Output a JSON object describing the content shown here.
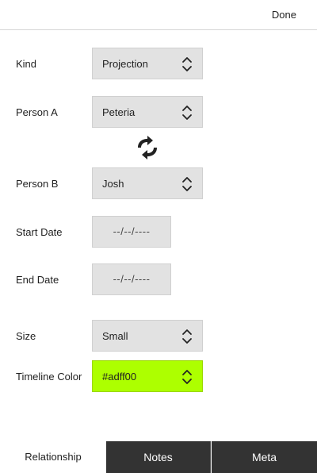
{
  "header": {
    "done_label": "Done"
  },
  "form": {
    "kind": {
      "label": "Kind",
      "value": "Projection"
    },
    "person_a": {
      "label": "Person A",
      "value": "Peteria"
    },
    "person_b": {
      "label": "Person B",
      "value": "Josh"
    },
    "start_date": {
      "label": "Start Date",
      "value": "--/--/----"
    },
    "end_date": {
      "label": "End Date",
      "value": "--/--/----"
    },
    "size": {
      "label": "Size",
      "value": "Small"
    },
    "timeline_color": {
      "label": "Timeline Color",
      "value": "#adff00",
      "swatch": "#adff00"
    }
  },
  "icons": {
    "swap": "swap-arrows-icon",
    "select": "chevron-up-down-icon"
  },
  "tabs": [
    {
      "label": "Relationship",
      "active": true
    },
    {
      "label": "Notes",
      "active": false
    },
    {
      "label": "Meta",
      "active": false
    }
  ],
  "colors": {
    "field_bg": "#e2e2e2",
    "tab_dark": "#333333",
    "accent_color_field": "#adff00"
  }
}
